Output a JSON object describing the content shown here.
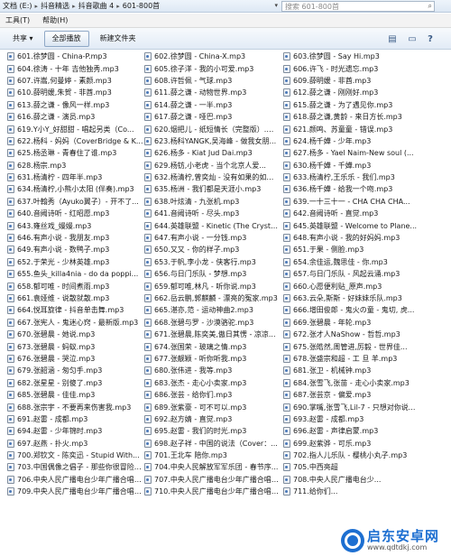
{
  "address": {
    "crumbs": [
      "文档 (E:)",
      "抖音精选",
      "抖音歌曲 4",
      "601-800首"
    ],
    "search_placeholder": "搜索 601-800首"
  },
  "menu": [
    "工具(T)",
    "帮助(H)"
  ],
  "toolbar": {
    "share": "共享 ▾",
    "play_all": "全部播放",
    "new_folder": "新建文件夹"
  },
  "files": {
    "col1": [
      "601.徐梦圆 - China-P.mp3",
      "604.徐涛 - 十年 吉他独秀.mp3",
      "607.许嵩,何曼婷 - 素颜.mp3",
      "610.薛明媛,朱贺 - 非酋.mp3",
      "613.薛之谦 - 像风一样.mp3",
      "616.薛之谦 - 演员.mp3",
      "619.Y小Y_好甜甜 - 唱起另类（Co...",
      "622.杨科 - 妈妈（CoverBridge & K...",
      "625.杨丞琳 - 青春住了谁.mp3",
      "628.杨宗.mp3",
      "631.杨清柠 - 四年半.mp3",
      "634.杨清柠,小熊小太阳 (伴奏).mp3",
      "637.叶翰秀（Ayuko翼子）- 开不了...",
      "640.音阙诗听 - 红昭愿.mp3",
      "643.雍丝戏_嫚嫚.mp3",
      "646.有声小说 - 我朋友.mp3",
      "649.有声小说 - 数鸭子.mp3",
      "652.于荣光 - 少林英雄.mp3",
      "655.鱼头_killa4nia - do da poppi...",
      "658.郁可唯 - 时间煮雨.mp3",
      "661.袁娅维 - 说散就散.mp3",
      "664.悦耳旋律 - 抖音单击舞.mp3",
      "667.张宪人 - 鬼迷心窍 - 最新版.mp3",
      "670.张碧晨 - 她说.mp3",
      "673.张碧晨 - 蚂蚁.mp3",
      "676.张碧晨 - 哭泣.mp3",
      "679.张韶涵 - 匆匀手.mp3",
      "682.张星星 - 别傻了.mp3",
      "685.张碧晨 - 佳佳.mp3",
      "688.张宗宇 - 不要再来伤害我.mp3",
      "691.赵雷 - 成都.mp3",
      "694.赵雷 - 少年锦时.mp3",
      "697.赵燕 - 扑火.mp3",
      "700.郑钦文 - 陈奕迅 - Stupid With...",
      "703.中国偶像之倡子 - 那些你很冒险的...",
      "706.中央人民广播电台少年广播合唱团...",
      "709.中央人民广播电台少年广播合唱团..."
    ],
    "col2": [
      "602.徐梦圆 - China-X.mp3",
      "605.徐子洋 - 我的小可爱.mp3",
      "608.许哲佩 - 气球.mp3",
      "611.薛之谦 - 动物世界.mp3",
      "614.薛之谦 - 一半.mp3",
      "617.薛之谦 - 哑巴.mp3",
      "620.烟把儿 - 纸短情长（完整版）.mp3",
      "623.杨科YANGK,吴海峰 - 做我女朋...",
      "626.杨多 - Kiat Jud Dai.mp3",
      "629.杨钫,小老虎 - 当个北京人爱...",
      "632.杨清柠,曾奕灿 - 没有如果的如果.mp3",
      "635.杨洲 - 我们都是天涯小.mp3",
      "638.叶炫清 - 九张机.mp3",
      "641.音阙诗听 - 尽头.mp3",
      "644.英雄联盟 - Kinetic (The Crysta...",
      "647.有声小说 - 一分钱.mp3",
      "650.又又 - 你的样子.mp3",
      "653.于帆,李小龙 - 侠客行.mp3",
      "656.与日门乐队 - 梦想.mp3",
      "659.郁可唯,林凡 - 听你说.mp3",
      "662.岳云鹏,郭麒麟 - 漂亮的冤家.mp3",
      "665.湛亦,范 - 运动神曲2.mp3",
      "668.张碧与罗 - 沙漠骆驼.mp3",
      "671.张碧晨,陈奕美,傲日其愣 - 凉凉...",
      "674.张国荣 - 玻璃之情.mp3",
      "677.张靓颖 - 听你听我.mp3",
      "680.张伟进 - 我等.mp3",
      "683.张杰 - 走心小卖家.mp3",
      "686.张芸 - 给你们.mp3",
      "689.张紫豪 - 可不可以.mp3",
      "692.赵方婧 - 直觉.mp3",
      "695.赵雷 - 我们的时光.mp3",
      "698.赵子祥 - 中国的说法（Cover：...",
      "701.王北车 陪你.mp3",
      "704.中央人民解放军军乐团 - 春节序...",
      "707.中央人民广播电台少年广播合唱团...",
      "710.中央人民广播电台少年广播合唱团..."
    ],
    "col3": [
      "603.徐梦圆 - Say Hi.mp3",
      "606.许飞 - 时光遗忘.mp3",
      "609.薛明媛 - 非酋.mp3",
      "612.薛之谦 - 刚刚好.mp3",
      "615.薛之谦 - 为了遇见你.mp3",
      "618.薛之谦,黄龄 - 来日方长.mp3",
      "621.颜鸣、苏童童 - 错误.mp3",
      "624.杨千嬅 - 少年.mp3",
      "627.杨多 - Yael Naim-New soul (...",
      "630.杨千嬅 - 千嬅.mp3",
      "633.杨清柠,王乐乐 - 我们.mp3",
      "636.杨千嬅 - 给我一个吻.mp3",
      "639.一十三十一 - CHA CHA CHA...",
      "642.音阙诗听 - 直觉.mp3",
      "645.英雄联盟 - Welcome to Plane...",
      "648.有声小说 - 我的好妈妈.mp3",
      "651.于果 - 侧脸.mp3",
      "654.余佳运,魏思佳 - 你.mp3",
      "657.与日门乐队 - 风起云涌.mp3",
      "660.心愿便利贴_原声.mp3",
      "663.云朵,斯斯 - 好妹妹乐队.mp3",
      "666.增田俊郎 - 鬼火の童 - 鬼切, 虎...",
      "669.张碧晨 - 年轮.mp3",
      "672.张才人NaShow - 哲哲.mp3",
      "675.张皓然,周管进,厉毅 - 世界佳...",
      "678.张盛宗和超 - 工 旦 羊.mp3",
      "681.张卫 - 机械钟.mp3",
      "684.张雪飞,张苗 - 走心小卖家.mp3",
      "687.张芸京 - 偏爱.mp3",
      "690.掌嘴,张雪飞,Lil-7 - 只想对你说...",
      "693.赵雷 - 成都.mp3",
      "696.赵雷 - 声律启蒙.mp3",
      "699.赵紫骅 - 可乐.mp3",
      "702.指人儿乐队 - 樱桃小丸子.mp3",
      "705.中西亮超",
      "708.中央人民广播电台少...",
      "711.给你们..."
    ]
  },
  "watermark": {
    "title": "启东安卓网",
    "url": "www.qdtdkj.com"
  }
}
